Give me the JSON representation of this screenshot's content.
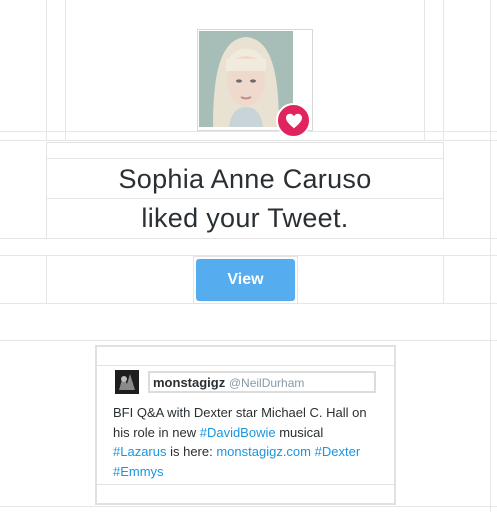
{
  "notification": {
    "user_name": "Sophia Anne Caruso",
    "action_text": "liked your Tweet.",
    "view_button_label": "View",
    "avatar_icon": "user-avatar",
    "badge_icon": "heart-icon",
    "badge_color": "#e0245e"
  },
  "tweet": {
    "username": "monstagigz",
    "handle": "@NeilDurham",
    "text_segments": [
      {
        "text": "BFI Q&A with Dexter star Michael C. Hall on his role in new ",
        "link": false
      },
      {
        "text": "#DavidBowie",
        "link": true
      },
      {
        "text": " musical ",
        "link": false
      },
      {
        "text": "#Lazarus",
        "link": true
      },
      {
        "text": " is here: ",
        "link": false
      },
      {
        "text": "monstagigz.com",
        "link": true
      },
      {
        "text": " ",
        "link": false
      },
      {
        "text": "#Dexter",
        "link": true
      },
      {
        "text": " ",
        "link": false
      },
      {
        "text": "#Emmys",
        "link": true
      }
    ]
  },
  "colors": {
    "link": "#1b95e0",
    "button": "#55acee",
    "text": "#292f33"
  }
}
